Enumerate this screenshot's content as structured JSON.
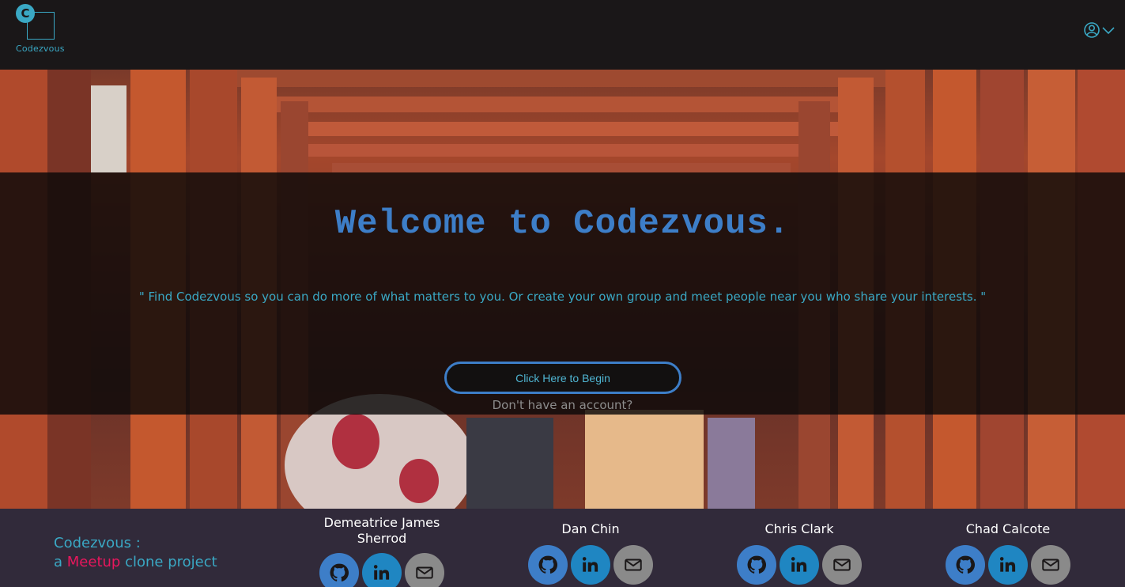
{
  "header": {
    "logo_letter": "C",
    "logo_text": "Codezvous",
    "profile_icon": "user-circle-icon",
    "dropdown_icon": "chevron-down-icon"
  },
  "hero": {
    "welcome": "Welcome to Codezvous.",
    "tagline": "\" Find Codezvous so you can do more of what matters to you. Or create your own group and meet people near you who share your interests. \"",
    "begin_button": "Click Here to Begin",
    "no_account": "Don't have an account?"
  },
  "footer": {
    "brand_line1": "Codezvous :",
    "brand_a": "a",
    "brand_meetup": "Meetup",
    "brand_rest": "clone project",
    "members": [
      {
        "name": "Demeatrice James Sherrod",
        "icons": [
          "github-icon",
          "linkedin-icon",
          "mail-icon"
        ]
      },
      {
        "name": "Dan Chin",
        "icons": [
          "github-icon",
          "linkedin-icon",
          "mail-icon"
        ]
      },
      {
        "name": "Chris Clark",
        "icons": [
          "github-icon",
          "linkedin-icon",
          "mail-icon"
        ]
      },
      {
        "name": "Chad Calcote",
        "icons": [
          "github-icon",
          "linkedin-icon",
          "mail-icon"
        ]
      }
    ]
  },
  "colors": {
    "accent": "#3aa8c4",
    "title_blue": "#3d7ec8",
    "meetup_red": "#e8175d",
    "footer_bg": "#312a3a",
    "header_bg": "#1a1718"
  }
}
